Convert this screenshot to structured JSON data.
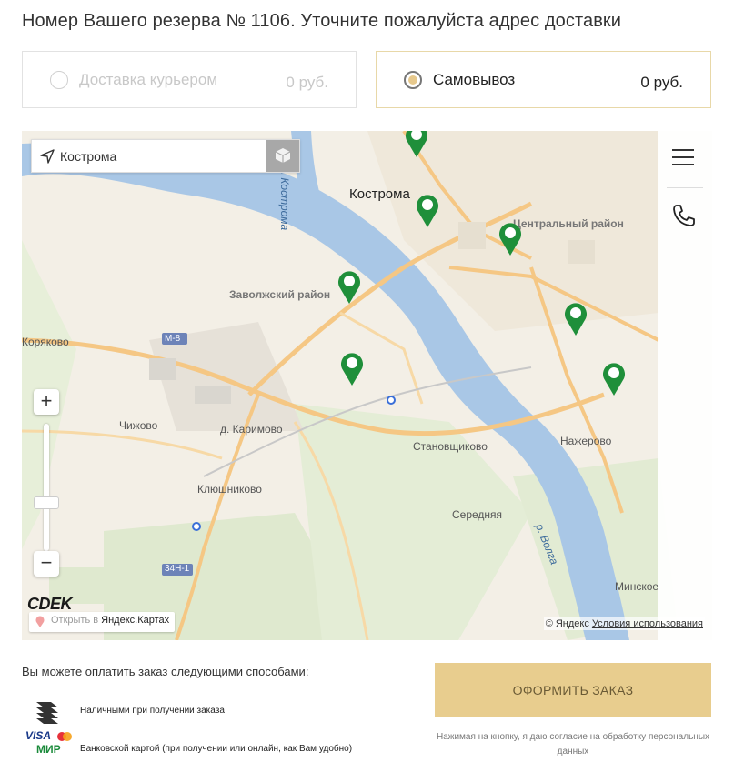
{
  "header": {
    "title": "Номер Вашего резерва № 1106. Уточните пожалуйста адрес доставки"
  },
  "delivery_options": [
    {
      "label": "Доставка курьером",
      "price": "0 руб.",
      "selected": false,
      "disabled": true
    },
    {
      "label": "Самовывоз",
      "price": "0 руб.",
      "selected": true,
      "disabled": false
    }
  ],
  "map": {
    "search_value": "Кострома",
    "labels": {
      "city": "Кострома",
      "river_kostroma": "р. Кострома",
      "river_volga": "р. Волга",
      "central": "Центральный район",
      "zavolzhsky": "Заволжский район",
      "koryakovo": "Коряково",
      "chizhovo": "Чижово",
      "karimovo": "д. Каримово",
      "klyushnikovo": "Клюшниково",
      "stanovshchikovo": "Становщиково",
      "serednyaya": "Середняя",
      "nazherovo": "Нажерово",
      "minskoe": "Минское",
      "m8": "М-8",
      "r34n1": "34Н-1"
    },
    "zoom_in": "+",
    "zoom_out": "−",
    "brand": "CDEK",
    "open_link_prefix": "Открыть в ",
    "open_link_service": "Яндекс.Картах",
    "copyright": "© Яндекс",
    "terms": "Условия использования",
    "marker_color": "#1f8f3a"
  },
  "payment": {
    "title": "Вы можете оплатить заказ следующими способами:",
    "methods": [
      {
        "icon": "cash-stack-icon",
        "label": "Наличными при получении заказа"
      },
      {
        "icon": "card-brands-icon",
        "label": "Банковской картой (при получении или онлайн, как Вам удобно)",
        "brands": [
          "VISA",
          "МИР"
        ]
      }
    ]
  },
  "order": {
    "button_label": "ОФОРМИТЬ ЗАКАЗ",
    "consent_text": "Нажимая на кнопку, я даю согласие на обработку персональных данных",
    "button_color": "#e8cd8e"
  }
}
